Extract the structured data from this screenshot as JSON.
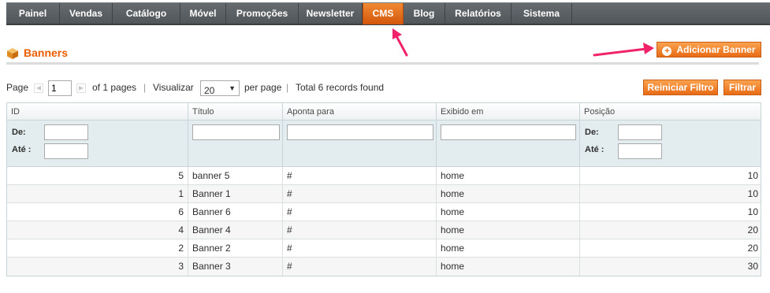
{
  "nav": {
    "items": [
      {
        "label": "Painel"
      },
      {
        "label": "Vendas"
      },
      {
        "label": "Catálogo"
      },
      {
        "label": "Móvel"
      },
      {
        "label": "Promoções"
      },
      {
        "label": "Newsletter"
      },
      {
        "label": "CMS",
        "active": true
      },
      {
        "label": "Blog"
      },
      {
        "label": "Relatórios"
      },
      {
        "label": "Sistema"
      }
    ]
  },
  "header": {
    "title": "Banners",
    "add_button": "Adicionar Banner"
  },
  "pager": {
    "page_label": "Page",
    "page_value": "1",
    "of_pages": "of 1 pages",
    "view_label": "Visualizar",
    "per_page_value": "20",
    "per_page_label": "per page",
    "total": "Total 6 records found"
  },
  "actions": {
    "reset_filter": "Reiniciar Filtro",
    "filter": "Filtrar"
  },
  "grid": {
    "columns": [
      "ID",
      "Título",
      "Aponta para",
      "Exibido em",
      "Posição"
    ],
    "filter_from": "De:",
    "filter_to": "Até :",
    "rows": [
      {
        "id": "5",
        "title": "banner 5",
        "target": "#",
        "shown_in": "home",
        "position": "10"
      },
      {
        "id": "1",
        "title": "Banner 1",
        "target": "#",
        "shown_in": "home",
        "position": "10"
      },
      {
        "id": "6",
        "title": "Banner 6",
        "target": "#",
        "shown_in": "home",
        "position": "10"
      },
      {
        "id": "4",
        "title": "Banner 4",
        "target": "#",
        "shown_in": "home",
        "position": "20"
      },
      {
        "id": "2",
        "title": "Banner 2",
        "target": "#",
        "shown_in": "home",
        "position": "20"
      },
      {
        "id": "3",
        "title": "Banner 3",
        "target": "#",
        "shown_in": "home",
        "position": "30"
      }
    ]
  },
  "colors": {
    "accent": "#eb5e00",
    "annotation_arrow": "#f0226a",
    "nav_bg": "#5b6064"
  }
}
